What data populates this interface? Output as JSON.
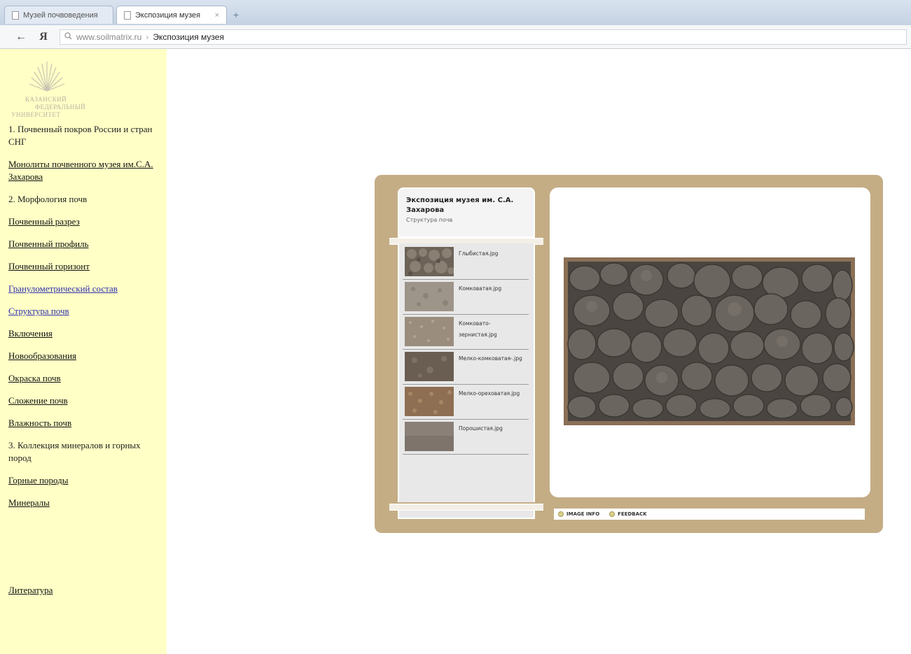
{
  "browser": {
    "tabs": [
      {
        "label": "Музей почвоведения",
        "active": false
      },
      {
        "label": "Экспозиция музея",
        "active": true
      }
    ],
    "new_tab_label": "+",
    "close_glyph": "×",
    "back_glyph": "←",
    "yandex_glyph": "Я",
    "search_glyph": "🔍",
    "url_domain": "www.soilmatrix.ru",
    "url_separator": "›",
    "url_title": "Экспозиция музея"
  },
  "sidebar": {
    "logo_text": [
      "КАЗАНСКИЙ",
      "ФЕДЕРАЛЬНЫЙ",
      "УНИВЕРСИТЕТ"
    ],
    "sections": [
      {
        "type": "heading",
        "label": "1. Почвенный покров России и стран СНГ"
      },
      {
        "type": "link",
        "label": "Монолиты почвенного музея им.С.А. Захарова"
      },
      {
        "type": "heading",
        "label": "2. Морфология почв"
      },
      {
        "type": "link",
        "label": "Почвенный разрез"
      },
      {
        "type": "link",
        "label": "Почвенный профиль"
      },
      {
        "type": "link",
        "label": "Почвенный горизонт"
      },
      {
        "type": "link",
        "label": "Гранулометрический состав",
        "visited": true
      },
      {
        "type": "link",
        "label": "Структура почв",
        "visited": true
      },
      {
        "type": "link",
        "label": "Включения"
      },
      {
        "type": "link",
        "label": "Новообразования"
      },
      {
        "type": "link",
        "label": "Окраска почв"
      },
      {
        "type": "link",
        "label": "Сложение почв"
      },
      {
        "type": "link",
        "label": "Влажность почв"
      },
      {
        "type": "heading",
        "label": "3. Коллекция минералов и горных пород"
      },
      {
        "type": "link",
        "label": "Горные породы"
      },
      {
        "type": "link",
        "label": "Минералы"
      }
    ],
    "literature_link": "Литература"
  },
  "gallery": {
    "title": "Экспозиция музея им. С.А. Захарова",
    "subtitle": "Структура почв",
    "items": [
      {
        "label": "Глыбистая.jpg"
      },
      {
        "label": "Комковатая.jpg"
      },
      {
        "label": "Комковато-зернистая.jpg"
      },
      {
        "label": "Мелко-комковатая-.jpg"
      },
      {
        "label": "Мелко-ореховатая.jpg"
      },
      {
        "label": "Порошистая.jpg"
      }
    ],
    "image_info_label": "IMAGE INFO",
    "feedback_label": "FEEDBACK"
  },
  "colors": {
    "sidebar_bg": "#ffffc6",
    "gallery_frame": "#c4ad85",
    "visited_link": "#3030b0"
  }
}
